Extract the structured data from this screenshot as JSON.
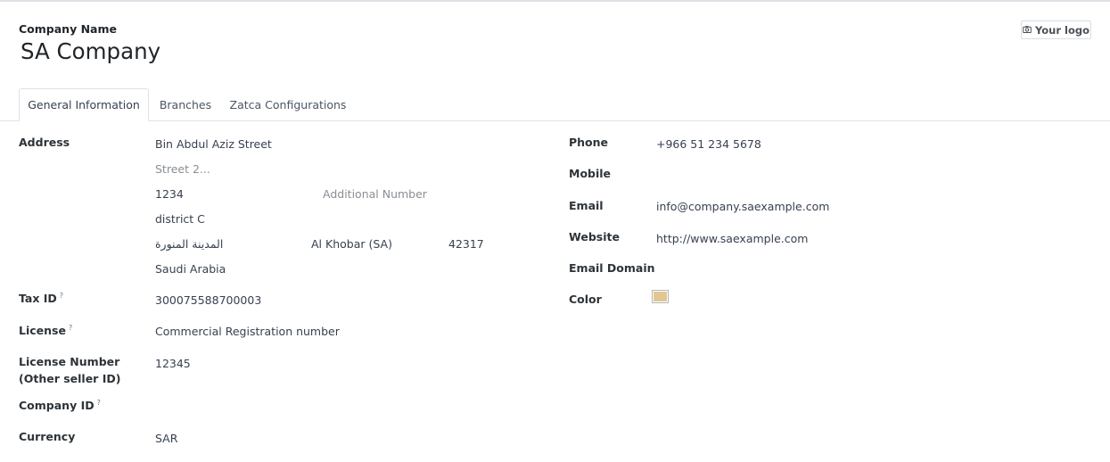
{
  "header": {
    "company_name_label": "Company Name",
    "company_name": "SA Company",
    "logo_button_label": "Your logo",
    "logo_icon": "camera-icon"
  },
  "tabs": [
    {
      "label": "General Information",
      "active": true
    },
    {
      "label": "Branches",
      "active": false
    },
    {
      "label": "Zatca Configurations",
      "active": false
    }
  ],
  "left": {
    "address_label": "Address",
    "street": "Bin Abdul Aziz Street",
    "street2_placeholder": "Street 2...",
    "building_number": "1234",
    "additional_number_placeholder": "Additional Number",
    "district": "district C",
    "city": "المدينة المنورة",
    "state": "Al Khobar (SA)",
    "zip": "42317",
    "country": "Saudi Arabia",
    "tax_id_label": "Tax ID",
    "tax_id": "300075588700003",
    "license_label": "License",
    "license": "Commercial Registration number",
    "license_number_label_line1": "License Number",
    "license_number_label_line2": "(Other seller ID)",
    "license_number": "12345",
    "company_id_label": "Company ID",
    "currency_label": "Currency",
    "currency": "SAR",
    "help_mark": "?"
  },
  "right": {
    "phone_label": "Phone",
    "phone": "+966 51 234 5678",
    "mobile_label": "Mobile",
    "email_label": "Email",
    "email": "info@company.saexample.com",
    "website_label": "Website",
    "website": "http://www.saexample.com",
    "email_domain_label": "Email Domain",
    "color_label": "Color",
    "color_value": "#e2c793"
  }
}
